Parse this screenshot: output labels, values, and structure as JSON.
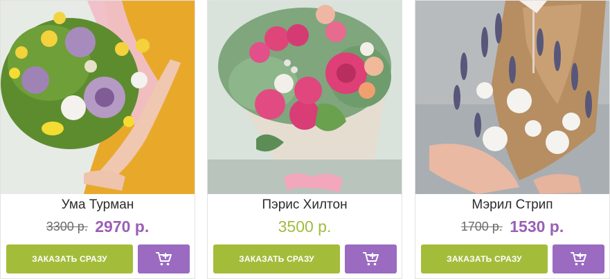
{
  "products": [
    {
      "name": "Ума Турман",
      "old_price": "3300 р.",
      "price": "2970 р.",
      "order_label": "ЗАКАЗАТЬ СРАЗУ",
      "cart_icon": "add-to-cart-icon"
    },
    {
      "name": "Пэрис Хилтон",
      "price": "3500 р.",
      "order_label": "ЗАКАЗАТЬ СРАЗУ",
      "cart_icon": "add-to-cart-icon"
    },
    {
      "name": "Мэрил Стрип",
      "old_price": "1700 р.",
      "price": "1530 р.",
      "order_label": "ЗАКАЗАТЬ СРАЗУ",
      "cart_icon": "add-to-cart-icon"
    }
  ],
  "colors": {
    "order_button": "#a3bd3b",
    "cart_button": "#9a6bc0",
    "sale_price": "#9a5fb5",
    "regular_price": "#a0bc3e"
  }
}
